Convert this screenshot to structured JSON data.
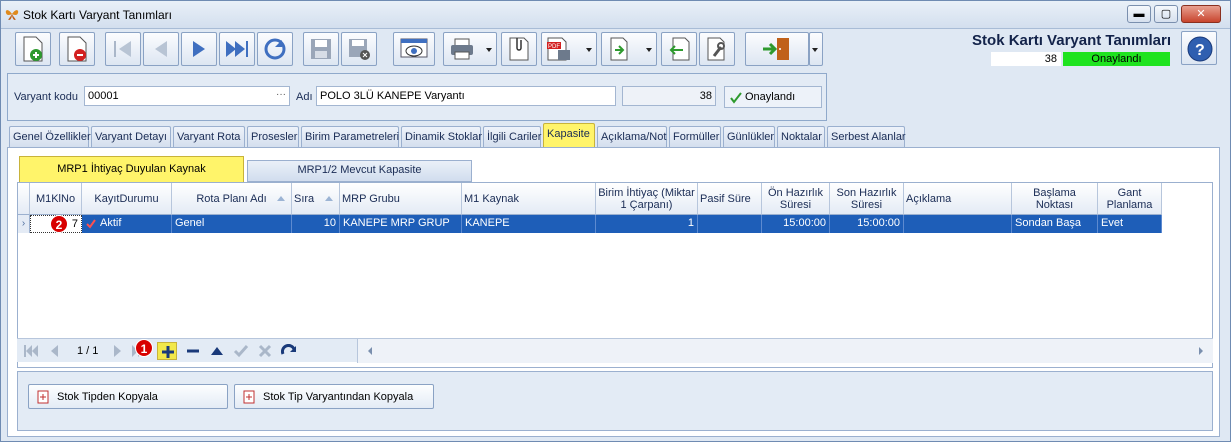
{
  "window": {
    "title": "Stok Kartı Varyant Tanımları"
  },
  "header": {
    "title": "Stok Kartı Varyant Tanımları",
    "record_number": "38",
    "status": "Onaylandı",
    "status_color": "#1fe31f"
  },
  "form": {
    "variant_code_label": "Varyant kodu",
    "variant_code_value": "00001",
    "variant_code_dots": "···",
    "name_label": "Adı",
    "name_value": "POLO 3LÜ KANEPE Varyantı",
    "number_value": "38",
    "approved_label": "Onaylandı"
  },
  "tabs": [
    "Genel Özellikler",
    "Varyant Detayı",
    "Varyant Rota",
    "Prosesler",
    "Birim Parametreleri",
    "Dinamik Stoklar",
    "İlgili Cariler",
    "Kapasite",
    "Açıklama/Not",
    "Formüller",
    "Günlükler",
    "Noktalar",
    "Serbest Alanlar"
  ],
  "active_tab": "Kapasite",
  "subtabs": {
    "active": "MRP1 İhtiyaç Duyulan Kaynak",
    "inactive": "MRP1/2 Mevcut Kapasite"
  },
  "grid": {
    "columns": [
      "M1KlNo",
      "KayıtDurumu",
      "Rota Planı Adı",
      "Sıra",
      "MRP Grubu",
      "M1 Kaynak",
      "Birim İhtiyaç (Miktar 1 Çarpanı)",
      "Pasif Süre",
      "Ön Hazırlık Süresi",
      "Son Hazırlık Süresi",
      "Açıklama",
      "Başlama Noktası",
      "Gant Planlama"
    ],
    "rows": [
      [
        "7",
        "Aktif",
        "Genel",
        "10",
        "KANEPE MRP GRUP",
        "KANEPE",
        "1",
        "",
        "15:00:00",
        "15:00:00",
        "",
        "Sondan Başa",
        "Evet"
      ]
    ],
    "row_indicator": "›"
  },
  "navigator": {
    "page": "1 / 1"
  },
  "annotations": {
    "one": "1",
    "two": "2"
  },
  "buttons": {
    "copy_type": "Stok Tipden Kopyala",
    "copy_type_variant": "Stok Tip Varyantından Kopyala"
  },
  "window_controls": {
    "minimize": "▬",
    "maximize": "▢",
    "close": "✕"
  },
  "colors": {
    "accent": "#1e5eb8",
    "tab_active": "#fff46a"
  }
}
